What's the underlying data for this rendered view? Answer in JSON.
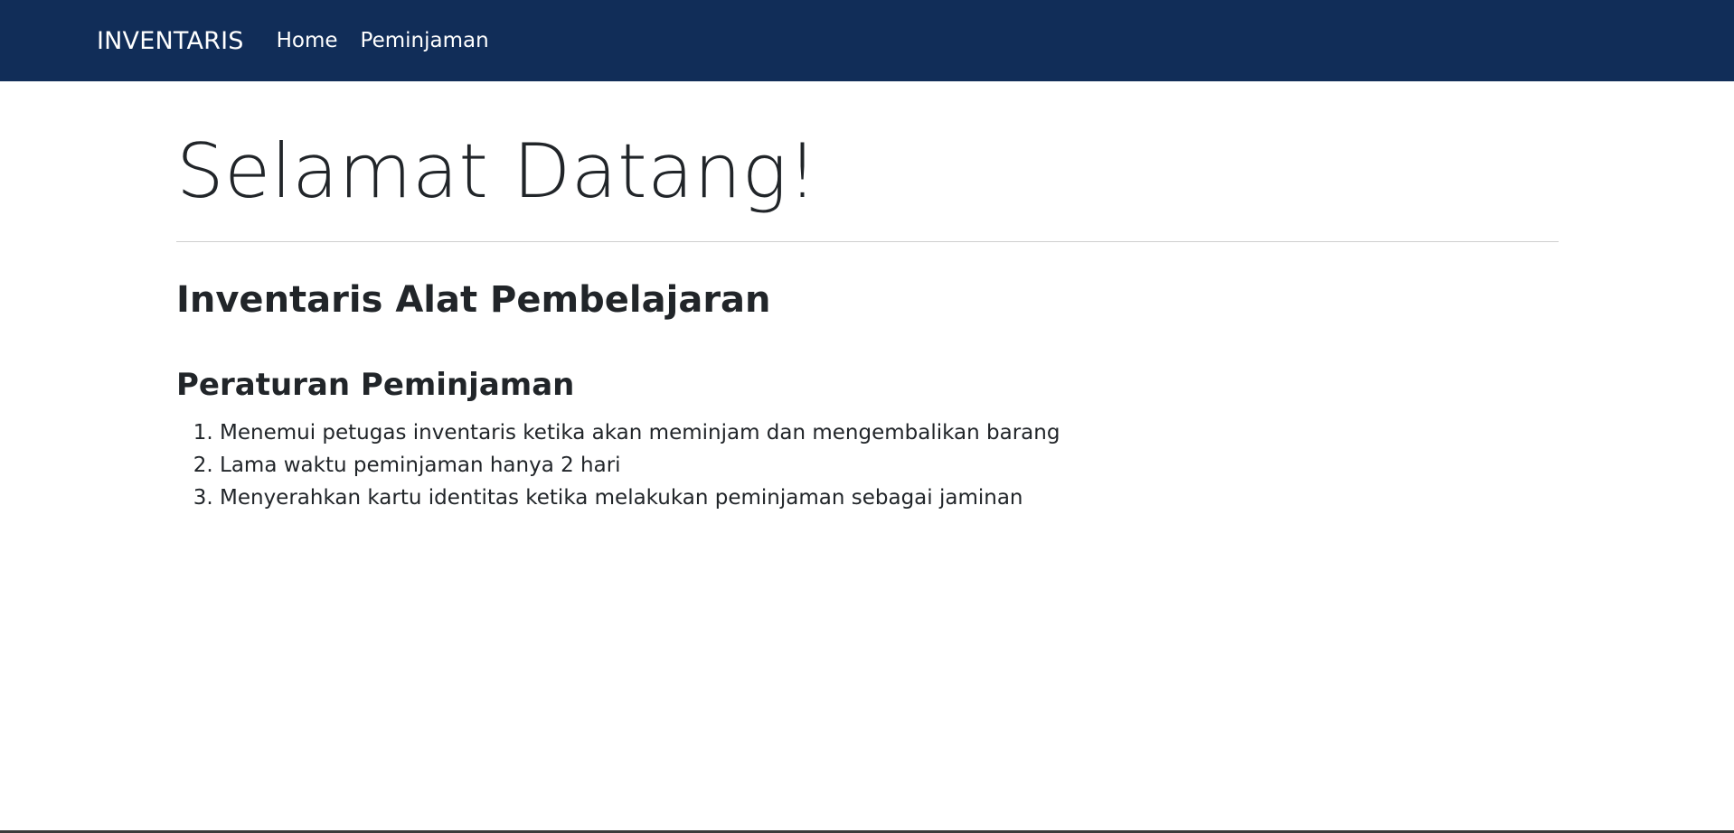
{
  "navbar": {
    "brand": "INVENTARIS",
    "links": [
      {
        "label": "Home"
      },
      {
        "label": "Peminjaman"
      }
    ],
    "background_color": "#112d58"
  },
  "main": {
    "hero_title": "Selamat Datang!",
    "subtitle": "Inventaris Alat Pembelajaran",
    "rules": {
      "title": "Peraturan Peminjaman",
      "items": [
        "Menemui petugas inventaris ketika akan meminjam dan mengembalikan barang",
        "Lama waktu peminjaman hanya 2 hari",
        "Menyerahkan kartu identitas ketika melakukan peminjaman sebagai jaminan"
      ]
    }
  }
}
